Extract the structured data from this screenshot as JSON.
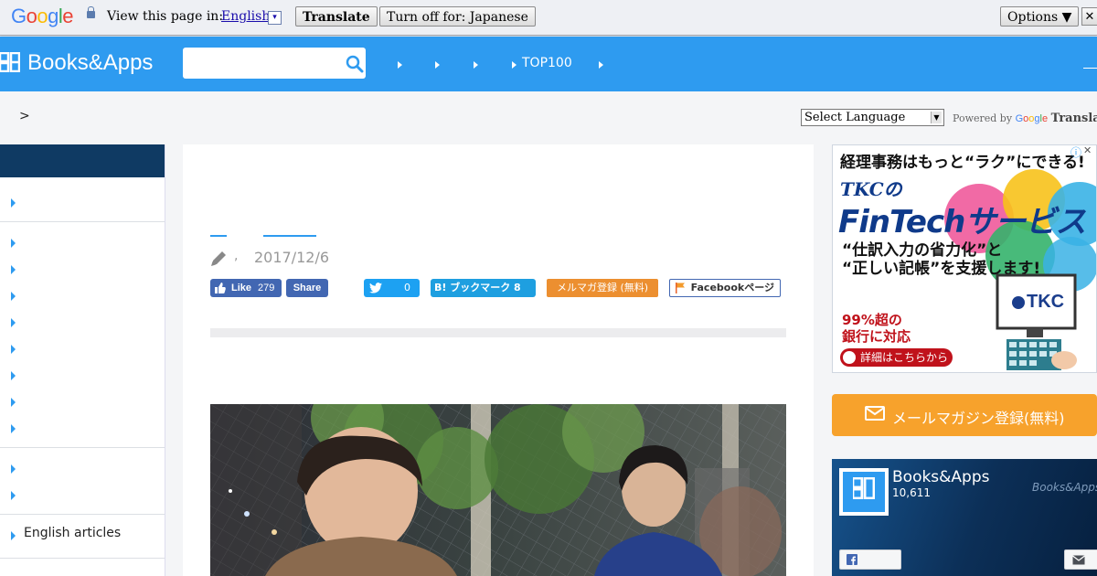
{
  "translate_bar": {
    "logo_letters": [
      "G",
      "o",
      "o",
      "g",
      "l",
      "e"
    ],
    "prompt": "View this page in:",
    "language": "English",
    "dropdown_glyph": "▾",
    "translate_button": "Translate",
    "turn_off_button": "Turn off for: Japanese",
    "options_button": "Options ▼",
    "close_glyph": "✕"
  },
  "header": {
    "brand": "Books&Apps",
    "search_placeholder": "",
    "nav": [
      {
        "label": ""
      },
      {
        "label": ""
      },
      {
        "label": ""
      },
      {
        "label": "TOP100"
      },
      {
        "label": ""
      }
    ]
  },
  "breadcrumb": ">",
  "language_select": {
    "selected": "Select Language",
    "powered_by": "Powered by",
    "google": [
      "G",
      "o",
      "o",
      "g",
      "l",
      "e"
    ],
    "translate": "Translate"
  },
  "sidebar": {
    "label": "English articles"
  },
  "article": {
    "comma": ",",
    "date": "2017/12/6",
    "fb_like_label": "Like",
    "fb_like_count": "279",
    "fb_share_label": "Share",
    "tweet_count": "0",
    "hatena_label": "B! ブックマーク 8",
    "mailmag_label": "メルマガ登録 (無料)",
    "facebook_page_label": "Facebookページ"
  },
  "ad": {
    "top": "経理事務はもっと“ラク”にできる!",
    "tkc_no": "TKCの",
    "fintech": "FinTechサービス",
    "line1": "“仕訳入力の省力化”と",
    "line2": "“正しい記帳”を支援します!",
    "red1": "99%超の",
    "red2": "銀行に対応",
    "cta": "詳細はこちらから",
    "brand": "TKC",
    "info_glyph": "ⓘ",
    "close_glyph": "✕"
  },
  "mail_button": {
    "label": "メールマガジン登録(無料)"
  },
  "fb_widget": {
    "name": "Books&Apps",
    "likes": "10,611",
    "watermark": "Books&Apps"
  },
  "colors": {
    "header_blue": "#2e9bf0",
    "sidebar_navy": "#0f3a63",
    "mail_orange": "#f7a22c",
    "facebook_blue": "#4267b2"
  }
}
